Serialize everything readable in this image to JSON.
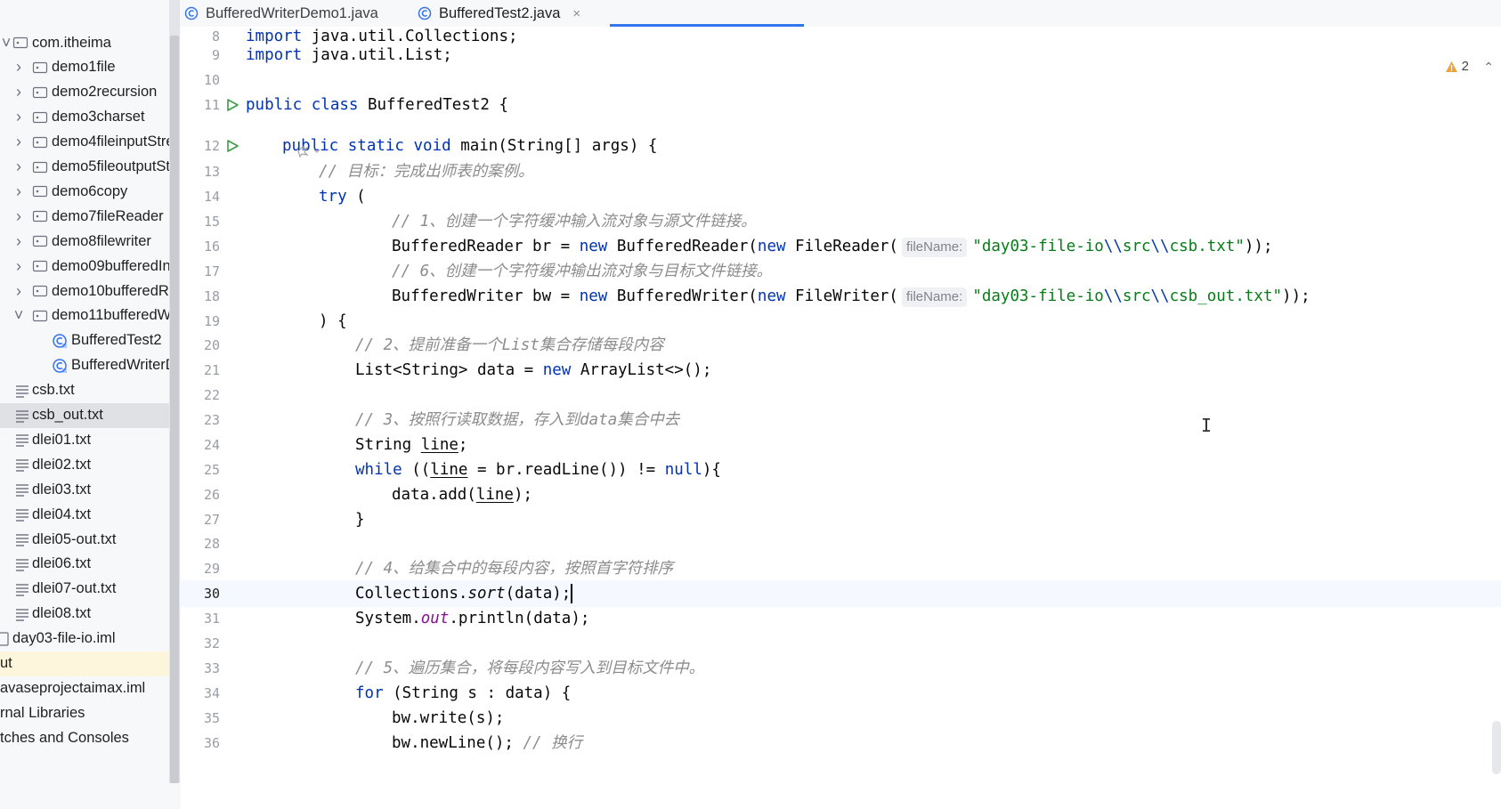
{
  "tabs": [
    {
      "label": "BufferedWriterDemo1.java",
      "active": false
    },
    {
      "label": "BufferedTest2.java",
      "active": true,
      "close": "×"
    }
  ],
  "project_tree": [
    {
      "label": "com.itheima",
      "kind": "package",
      "expanded": true
    },
    {
      "label": "demo1file",
      "kind": "package"
    },
    {
      "label": "demo2recursion",
      "kind": "package"
    },
    {
      "label": "demo3charset",
      "kind": "package"
    },
    {
      "label": "demo4fileinputStre",
      "kind": "package"
    },
    {
      "label": "demo5fileoutputSt",
      "kind": "package"
    },
    {
      "label": "demo6copy",
      "kind": "package"
    },
    {
      "label": "demo7fileReader",
      "kind": "package"
    },
    {
      "label": "demo8filewriter",
      "kind": "package"
    },
    {
      "label": "demo09bufferedIn",
      "kind": "package"
    },
    {
      "label": "demo10bufferedRe",
      "kind": "package"
    },
    {
      "label": "demo11bufferedW",
      "kind": "package",
      "expanded": true
    },
    {
      "label": "BufferedTest2",
      "kind": "class"
    },
    {
      "label": "BufferedWriterD",
      "kind": "class"
    },
    {
      "label": "csb.txt",
      "kind": "text"
    },
    {
      "label": "csb_out.txt",
      "kind": "text",
      "selected": true
    },
    {
      "label": "dlei01.txt",
      "kind": "text"
    },
    {
      "label": "dlei02.txt",
      "kind": "text"
    },
    {
      "label": "dlei03.txt",
      "kind": "text"
    },
    {
      "label": "dlei04.txt",
      "kind": "text"
    },
    {
      "label": "dlei05-out.txt",
      "kind": "text"
    },
    {
      "label": "dlei06.txt",
      "kind": "text"
    },
    {
      "label": "dlei07-out.txt",
      "kind": "text"
    },
    {
      "label": "dlei08.txt",
      "kind": "text"
    },
    {
      "label": "day03-file-io.iml",
      "kind": "module"
    },
    {
      "label": "ut",
      "kind": "folder",
      "highlight": true
    },
    {
      "label": "avaseprojectaimax.iml",
      "kind": "plain"
    },
    {
      "label": "rnal Libraries",
      "kind": "plain"
    },
    {
      "label": "tches and Consoles",
      "kind": "plain"
    }
  ],
  "editor": {
    "warnings_count": "2",
    "current_line": 30,
    "lines": [
      {
        "n": "8",
        "indent": 0,
        "tokens": [
          {
            "t": "import",
            "c": "kw"
          },
          {
            "t": " java.util.Collections;"
          }
        ]
      },
      {
        "n": "9",
        "indent": 0,
        "tokens": [
          {
            "t": "import",
            "c": "kw"
          },
          {
            "t": " java.util.List;"
          }
        ]
      },
      {
        "n": "10",
        "indent": 0,
        "tokens": []
      },
      {
        "n": "11",
        "indent": 0,
        "run": true,
        "tokens": [
          {
            "t": "public class",
            "c": "kw"
          },
          {
            "t": " BufferedTest2 {"
          }
        ]
      },
      {
        "n": "",
        "indent": 0,
        "tokens": []
      },
      {
        "n": "12",
        "indent": 1,
        "run": true,
        "tokens": [
          {
            "t": "public static void",
            "c": "kw"
          },
          {
            "t": " main(String[] args) {"
          }
        ]
      },
      {
        "n": "13",
        "indent": 2,
        "tokens": [
          {
            "t": "// 目标：完成出师表的案例。",
            "c": "cm"
          }
        ]
      },
      {
        "n": "14",
        "indent": 2,
        "tokens": [
          {
            "t": "try",
            "c": "kw"
          },
          {
            "t": " ("
          }
        ]
      },
      {
        "n": "15",
        "indent": 4,
        "tokens": [
          {
            "t": "// 1、创建一个字符缓冲输入流对象与源文件链接。",
            "c": "cm"
          }
        ]
      },
      {
        "n": "16",
        "indent": 4,
        "tokens": [
          {
            "t": "BufferedReader br = "
          },
          {
            "t": "new",
            "c": "kw"
          },
          {
            "t": " BufferedReader("
          },
          {
            "t": "new",
            "c": "kw"
          },
          {
            "t": " FileReader("
          },
          {
            "t": "fileName:",
            "c": "hint"
          },
          {
            "t": "\"day03-file-io",
            "c": "st"
          },
          {
            "t": "\\\\",
            "c": "st-esc"
          },
          {
            "t": "src",
            "c": "st"
          },
          {
            "t": "\\\\",
            "c": "st-esc"
          },
          {
            "t": "csb.txt\"",
            "c": "st"
          },
          {
            "t": "));"
          }
        ]
      },
      {
        "n": "17",
        "indent": 4,
        "tokens": [
          {
            "t": "// 6、创建一个字符缓冲输出流对象与目标文件链接。",
            "c": "cm"
          }
        ]
      },
      {
        "n": "18",
        "indent": 4,
        "tokens": [
          {
            "t": "BufferedWriter bw = "
          },
          {
            "t": "new",
            "c": "kw"
          },
          {
            "t": " BufferedWriter("
          },
          {
            "t": "new",
            "c": "kw"
          },
          {
            "t": " FileWriter("
          },
          {
            "t": "fileName:",
            "c": "hint"
          },
          {
            "t": "\"day03-file-io",
            "c": "st"
          },
          {
            "t": "\\\\",
            "c": "st-esc"
          },
          {
            "t": "src",
            "c": "st"
          },
          {
            "t": "\\\\",
            "c": "st-esc"
          },
          {
            "t": "csb_out.txt\"",
            "c": "st"
          },
          {
            "t": "));"
          }
        ]
      },
      {
        "n": "19",
        "indent": 2,
        "tokens": [
          {
            "t": ") {"
          }
        ]
      },
      {
        "n": "20",
        "indent": 3,
        "tokens": [
          {
            "t": "// 2、提前准备一个List集合存储每段内容",
            "c": "cm"
          }
        ]
      },
      {
        "n": "21",
        "indent": 3,
        "tokens": [
          {
            "t": "List<String> data = "
          },
          {
            "t": "new",
            "c": "kw"
          },
          {
            "t": " ArrayList<>();"
          }
        ]
      },
      {
        "n": "22",
        "indent": 0,
        "tokens": []
      },
      {
        "n": "23",
        "indent": 3,
        "tokens": [
          {
            "t": "// 3、按照行读取数据，存入到data集合中去",
            "c": "cm"
          }
        ]
      },
      {
        "n": "24",
        "indent": 3,
        "tokens": [
          {
            "t": "String "
          },
          {
            "t": "line",
            "c": "ul"
          },
          {
            "t": ";"
          }
        ]
      },
      {
        "n": "25",
        "indent": 3,
        "tokens": [
          {
            "t": "while",
            "c": "kw"
          },
          {
            "t": " (("
          },
          {
            "t": "line",
            "c": "ul"
          },
          {
            "t": " = br.readLine()) != "
          },
          {
            "t": "null",
            "c": "kw"
          },
          {
            "t": "){"
          }
        ]
      },
      {
        "n": "26",
        "indent": 4,
        "tokens": [
          {
            "t": "data.add("
          },
          {
            "t": "line",
            "c": "ul"
          },
          {
            "t": ");"
          }
        ]
      },
      {
        "n": "27",
        "indent": 3,
        "tokens": [
          {
            "t": "}"
          }
        ]
      },
      {
        "n": "28",
        "indent": 0,
        "tokens": []
      },
      {
        "n": "29",
        "indent": 3,
        "tokens": [
          {
            "t": "// 4、给集合中的每段内容，按照首字符排序",
            "c": "cm"
          }
        ]
      },
      {
        "n": "30",
        "indent": 3,
        "current": true,
        "tokens": [
          {
            "t": "Collections."
          },
          {
            "t": "sort",
            "c": "it"
          },
          {
            "t": "(data);"
          }
        ]
      },
      {
        "n": "31",
        "indent": 3,
        "tokens": [
          {
            "t": "System."
          },
          {
            "t": "out",
            "c": "fld"
          },
          {
            "t": ".println(data);"
          }
        ]
      },
      {
        "n": "32",
        "indent": 0,
        "tokens": []
      },
      {
        "n": "33",
        "indent": 3,
        "tokens": [
          {
            "t": "// 5、遍历集合，将每段内容写入到目标文件中。",
            "c": "cm"
          }
        ]
      },
      {
        "n": "34",
        "indent": 3,
        "tokens": [
          {
            "t": "for",
            "c": "kw"
          },
          {
            "t": " (String s : data) {"
          }
        ]
      },
      {
        "n": "35",
        "indent": 4,
        "tokens": [
          {
            "t": "bw.write(s);"
          }
        ]
      },
      {
        "n": "36",
        "indent": 4,
        "tokens": [
          {
            "t": "bw.newLine(); "
          },
          {
            "t": "// 换行",
            "c": "cm"
          }
        ]
      }
    ]
  },
  "colors": {
    "keyword": "#0033b3",
    "comment": "#8c8c8c",
    "string": "#067d17",
    "accent": "#3574f0"
  }
}
